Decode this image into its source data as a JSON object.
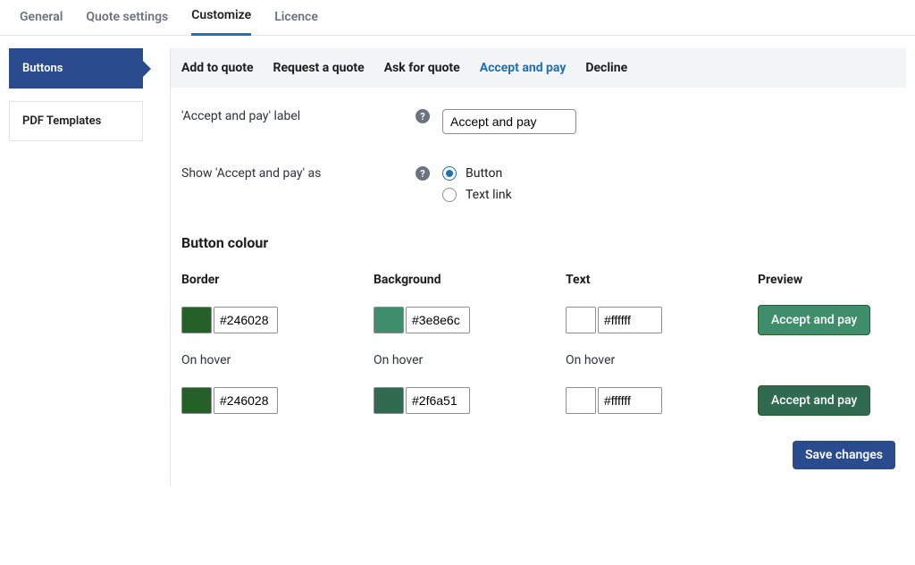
{
  "topTabs": {
    "general": "General",
    "quote": "Quote settings",
    "customize": "Customize",
    "licence": "Licence"
  },
  "sidebar": {
    "buttons": "Buttons",
    "pdf": "PDF Templates"
  },
  "subTabs": {
    "addToQuote": "Add to quote",
    "request": "Request a quote",
    "ask": "Ask for quote",
    "accept": "Accept and pay",
    "decline": "Decline"
  },
  "form": {
    "labelRow": "'Accept and pay' label",
    "labelValue": "Accept and pay",
    "showAs": "Show 'Accept and pay' as",
    "showAsOptions": {
      "button": "Button",
      "link": "Text link"
    }
  },
  "section": {
    "title": "Button colour"
  },
  "colorGrid": {
    "headers": {
      "border": "Border",
      "bg": "Background",
      "text": "Text",
      "preview": "Preview"
    },
    "hoverLabel": "On hover",
    "base": {
      "border": "#246028",
      "bg": "#3e8e6c",
      "text": "#ffffff"
    },
    "hover": {
      "border": "#246028",
      "bg": "#2f6a51",
      "text": "#ffffff"
    },
    "previewLabel": "Accept and pay"
  },
  "save": "Save changes"
}
